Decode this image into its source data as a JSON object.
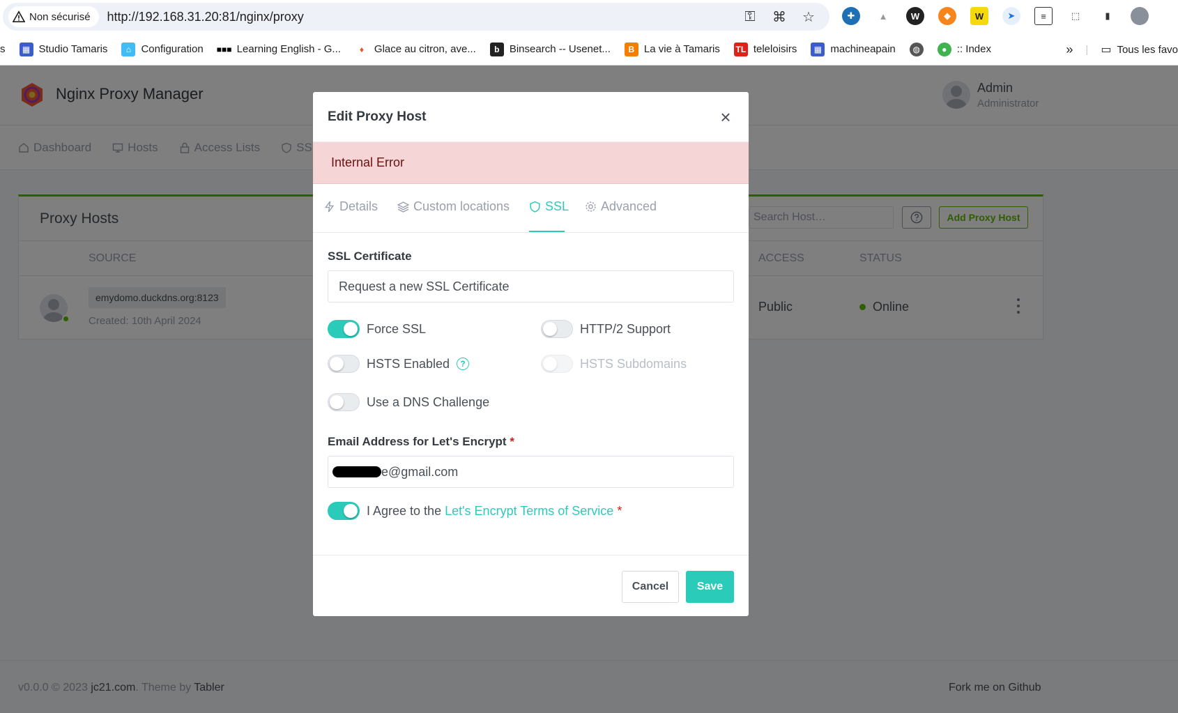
{
  "browser": {
    "security_label": "Non sécurisé",
    "url": "http://192.168.31.20:81/nginx/proxy",
    "bookmarks": [
      {
        "label": "s"
      },
      {
        "label": "Studio Tamaris"
      },
      {
        "label": "Configuration"
      },
      {
        "label": "Learning English - G..."
      },
      {
        "label": "Glace au citron, ave..."
      },
      {
        "label": "Binsearch -- Usenet..."
      },
      {
        "label": "La vie à Tamaris"
      },
      {
        "label": "teleloisirs"
      },
      {
        "label": "machineapain"
      },
      {
        "label": ":: Index"
      }
    ],
    "all_bookmarks_label": "Tous les favo"
  },
  "app": {
    "brand": "Nginx Proxy Manager",
    "user_name": "Admin",
    "user_role": "Administrator",
    "nav": {
      "dashboard": "Dashboard",
      "hosts": "Hosts",
      "access_lists": "Access Lists",
      "ssl": "SSL"
    },
    "card": {
      "title": "Proxy Hosts",
      "search_placeholder": "Search Host…",
      "add_button": "Add Proxy Host",
      "columns": {
        "source": "Source",
        "access": "Access",
        "status": "Status"
      },
      "rows": [
        {
          "domain": "emydomo.duckdns.org:8123",
          "created": "Created: 10th April 2024",
          "access": "Public",
          "status": "Online"
        }
      ]
    },
    "footer": {
      "version": "v0.0.0 © 2023",
      "company": "jc21.com",
      "theme_by": ". Theme by",
      "theme": "Tabler",
      "fork": "Fork me on Github"
    }
  },
  "modal": {
    "title": "Edit Proxy Host",
    "error": "Internal Error",
    "tabs": {
      "details": "Details",
      "custom_locations": "Custom locations",
      "ssl": "SSL",
      "advanced": "Advanced"
    },
    "active_tab": "SSL",
    "ssl_certificate_label": "SSL Certificate",
    "ssl_certificate_value": "Request a new SSL Certificate",
    "toggles": {
      "force_ssl": {
        "label": "Force SSL",
        "on": true
      },
      "http2": {
        "label": "HTTP/2 Support",
        "on": false
      },
      "hsts": {
        "label": "HSTS Enabled",
        "on": false
      },
      "hsts_sub": {
        "label": "HSTS Subdomains",
        "on": false,
        "disabled": true
      },
      "dns": {
        "label": "Use a DNS Challenge",
        "on": false
      },
      "agree": {
        "label_prefix": "I Agree to the",
        "link": "Let's Encrypt Terms of Service",
        "on": true
      }
    },
    "email_label": "Email Address for Let's Encrypt",
    "email_value": "e@gmail.com",
    "required_mark": "*",
    "cancel": "Cancel",
    "save": "Save"
  },
  "colors": {
    "accent": "#2bcbba",
    "success": "#5eba00",
    "error_bg": "#f6d5d6"
  }
}
